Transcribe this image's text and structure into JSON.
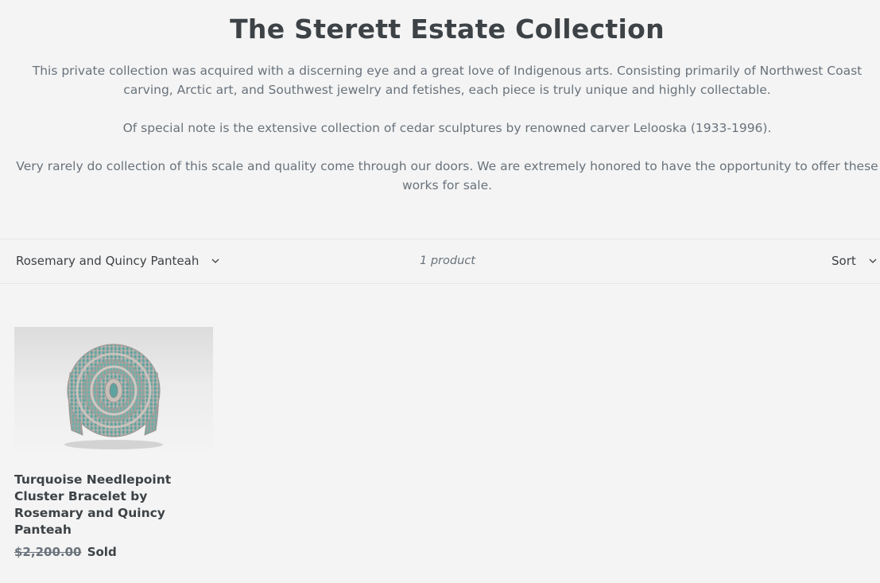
{
  "collection": {
    "title": "The Sterett Estate Collection",
    "paragraphs": [
      "This private collection was acquired with a discerning eye and a great love of Indigenous arts. Consisting primarily of Northwest Coast carving, Arctic art, and Southwest jewelry and fetishes, each piece is truly unique and highly collectable.",
      "Of special note is the extensive collection of cedar sculptures by renowned carver Lelooska (1933-1996).",
      "Very rarely do collection of this scale and quality come through our doors. We are extremely honored to have the opportunity to offer these works for sale."
    ]
  },
  "filters": {
    "filter_value": "Rosemary and Quincy Panteah",
    "filter_icon": "chevron-down-icon",
    "product_count": "1 product",
    "sort_label": "Sort",
    "sort_icon": "chevron-down-icon"
  },
  "products": [
    {
      "title": "Turquoise Needlepoint Cluster Bracelet by Rosemary and Quincy Panteah",
      "price": "$2,200.00",
      "status": "Sold",
      "image": "turquoise-needlepoint-cluster-bracelet"
    }
  ],
  "colors": {
    "background": "#f4f4f4",
    "heading": "#3d4246",
    "body_text": "#69727b",
    "turquoise": "#5fa3a0",
    "silver": "#b8b0ac"
  }
}
